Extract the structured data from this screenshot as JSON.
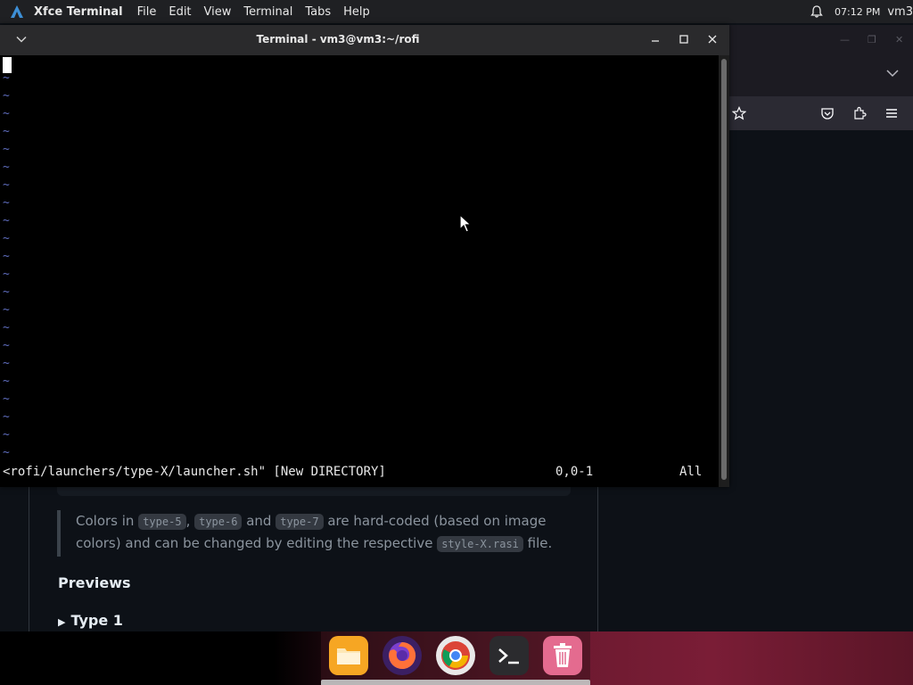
{
  "top_panel": {
    "app_name": "Xfce Terminal",
    "menu": [
      "File",
      "Edit",
      "View",
      "Terminal",
      "Tabs",
      "Help"
    ],
    "clock": "07:12 PM",
    "user": "vm3"
  },
  "terminal": {
    "title": "Terminal - vm3@vm3:~/rofi",
    "tilde_char": "~",
    "status_left": "<rofi/launchers/type-X/launcher.sh\" [New DIRECTORY]",
    "status_pos": "0,0-1",
    "status_scroll": "All"
  },
  "page": {
    "quote": {
      "p1": "Colors in ",
      "code1": "type-5",
      "p2": ", ",
      "code2": "type-6",
      "p3": " and ",
      "code3": "type-7",
      "p4": " are hard-coded (based on image colors) and can be changed by editing the respective ",
      "code4": "style-X.rasi",
      "p5": " file."
    },
    "previews_heading": "Previews",
    "type1_label": "Type 1"
  },
  "dock": {
    "icons": [
      "files-icon",
      "firefox-icon",
      "chrome-icon",
      "terminal-icon",
      "trash-icon"
    ]
  },
  "colors": {
    "tilde": "#5f6dbe",
    "panel": "#1f2023",
    "terminal_bg": "#000000"
  }
}
